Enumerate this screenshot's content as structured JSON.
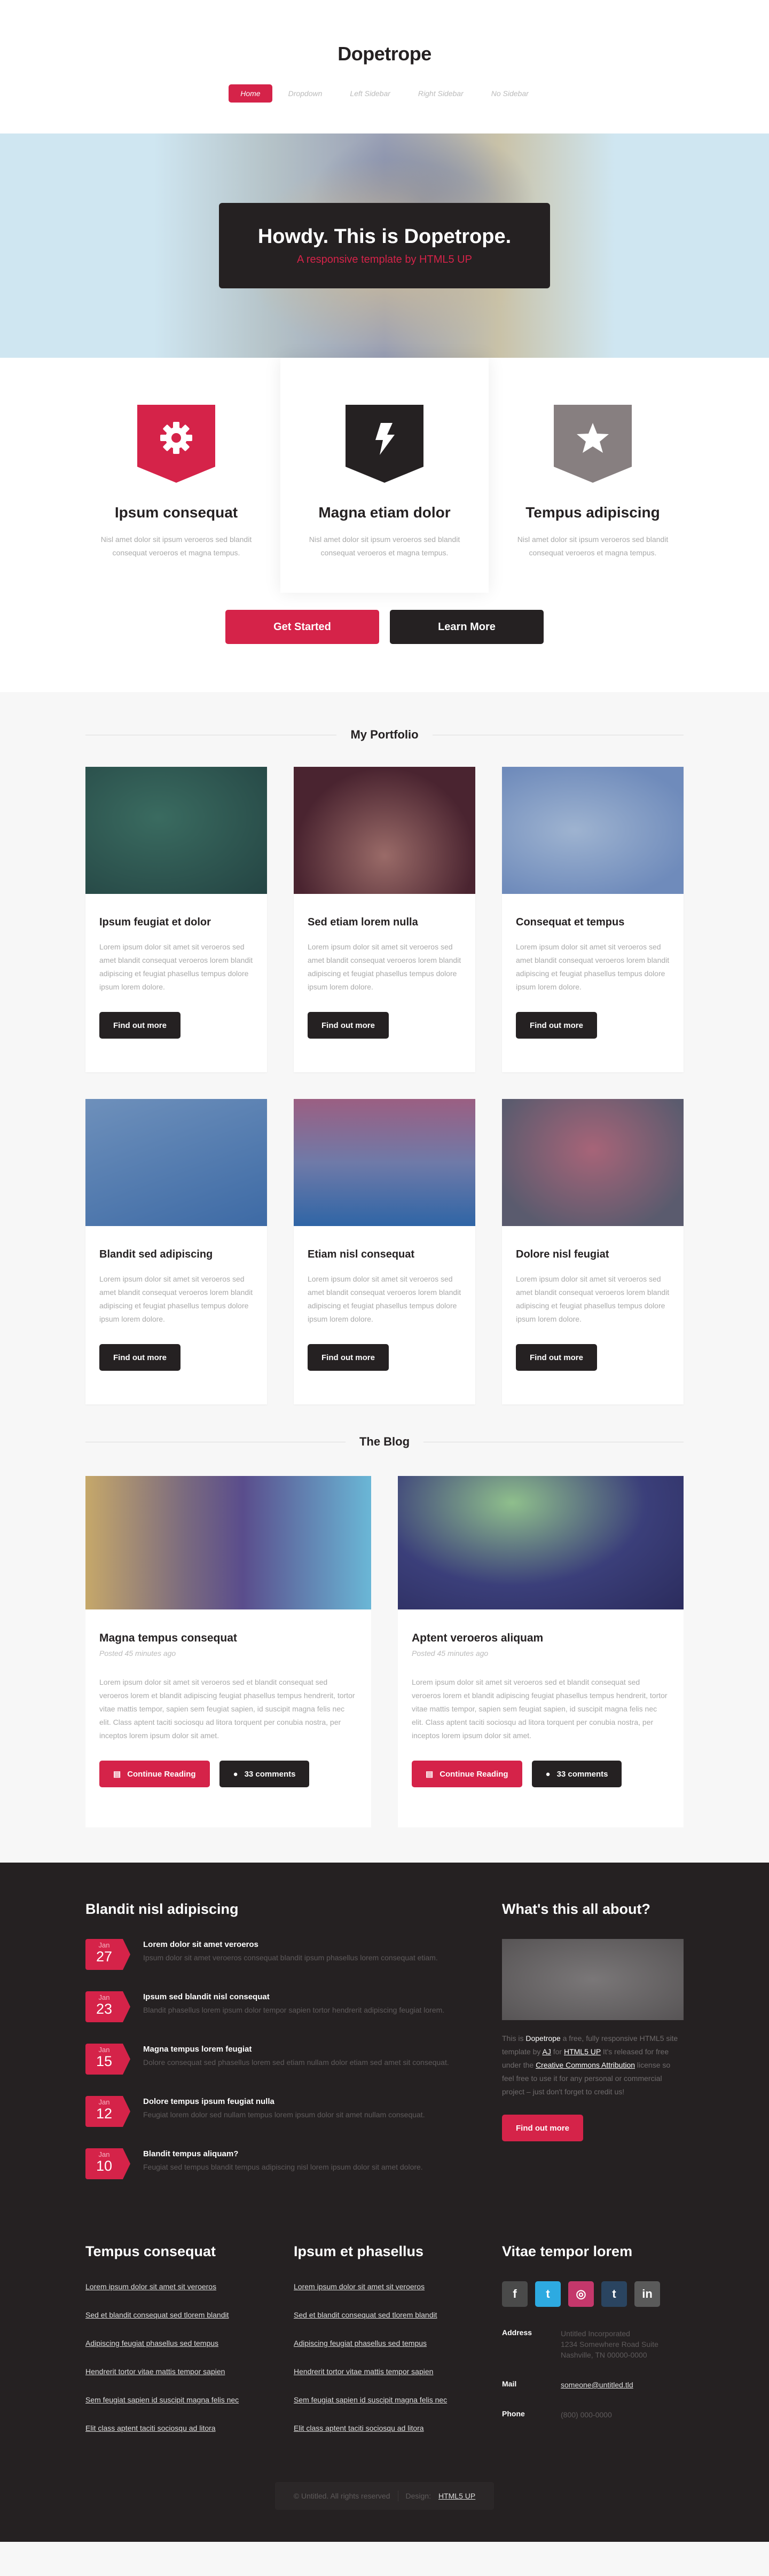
{
  "site": {
    "logo": "Dopetrope"
  },
  "nav": [
    {
      "label": "Home",
      "active": true
    },
    {
      "label": "Dropdown",
      "active": false
    },
    {
      "label": "Left Sidebar",
      "active": false
    },
    {
      "label": "Right Sidebar",
      "active": false
    },
    {
      "label": "No Sidebar",
      "active": false
    }
  ],
  "banner": {
    "title": "Howdy. This is Dopetrope.",
    "subtitle": "A responsive template by HTML5 UP"
  },
  "features": [
    {
      "icon": "gear-icon",
      "title": "Ipsum consequat",
      "text": "Nisl amet dolor sit ipsum veroeros sed blandit consequat veroeros et magna tempus.",
      "color": "#d52349"
    },
    {
      "icon": "bolt-icon",
      "title": "Magna etiam dolor",
      "text": "Nisl amet dolor sit ipsum veroeros sed blandit consequat veroeros et magna tempus.",
      "color": "#252122"
    },
    {
      "icon": "star-icon",
      "title": "Tempus adipiscing",
      "text": "Nisl amet dolor sit ipsum veroeros sed blandit consequat veroeros et magna tempus.",
      "color": "#877f80"
    }
  ],
  "intro_buttons": {
    "primary": "Get Started",
    "secondary": "Learn More"
  },
  "portfolio": {
    "title": "My Portfolio",
    "items": [
      {
        "title": "Ipsum feugiat et dolor",
        "text": "Lorem ipsum dolor sit amet sit veroeros sed amet blandit consequat veroeros lorem blandit adipiscing et feugiat phasellus tempus dolore ipsum lorem dolore.",
        "button": "Find out more"
      },
      {
        "title": "Sed etiam lorem nulla",
        "text": "Lorem ipsum dolor sit amet sit veroeros sed amet blandit consequat veroeros lorem blandit adipiscing et feugiat phasellus tempus dolore ipsum lorem dolore.",
        "button": "Find out more"
      },
      {
        "title": "Consequat et tempus",
        "text": "Lorem ipsum dolor sit amet sit veroeros sed amet blandit consequat veroeros lorem blandit adipiscing et feugiat phasellus tempus dolore ipsum lorem dolore.",
        "button": "Find out more"
      },
      {
        "title": "Blandit sed adipiscing",
        "text": "Lorem ipsum dolor sit amet sit veroeros sed amet blandit consequat veroeros lorem blandit adipiscing et feugiat phasellus tempus dolore ipsum lorem dolore.",
        "button": "Find out more"
      },
      {
        "title": "Etiam nisl consequat",
        "text": "Lorem ipsum dolor sit amet sit veroeros sed amet blandit consequat veroeros lorem blandit adipiscing et feugiat phasellus tempus dolore ipsum lorem dolore.",
        "button": "Find out more"
      },
      {
        "title": "Dolore nisl feugiat",
        "text": "Lorem ipsum dolor sit amet sit veroeros sed amet blandit consequat veroeros lorem blandit adipiscing et feugiat phasellus tempus dolore ipsum lorem dolore.",
        "button": "Find out more"
      }
    ]
  },
  "blog": {
    "title": "The Blog",
    "posts": [
      {
        "title": "Magna tempus consequat",
        "meta": "Posted 45 minutes ago",
        "text": "Lorem ipsum dolor sit amet sit veroeros sed et blandit consequat sed veroeros lorem et blandit adipiscing feugiat phasellus tempus hendrerit, tortor vitae mattis tempor, sapien sem feugiat sapien, id suscipit magna felis nec elit. Class aptent taciti sociosqu ad litora torquent per conubia nostra, per inceptos lorem ipsum dolor sit amet.",
        "read": "Continue Reading",
        "comments": "33 comments"
      },
      {
        "title": "Aptent veroeros aliquam",
        "meta": "Posted 45 minutes ago",
        "text": "Lorem ipsum dolor sit amet sit veroeros sed et blandit consequat sed veroeros lorem et blandit adipiscing feugiat phasellus tempus hendrerit, tortor vitae mattis tempor, sapien sem feugiat sapien, id suscipit magna felis nec elit. Class aptent taciti sociosqu ad litora torquent per conubia nostra, per inceptos lorem ipsum dolor sit amet.",
        "read": "Continue Reading",
        "comments": "33 comments"
      }
    ]
  },
  "footer": {
    "news_title": "Blandit nisl adipiscing",
    "news": [
      {
        "month": "Jan",
        "day": "27",
        "title": "Lorem dolor sit amet veroeros",
        "text": "Ipsum dolor sit amet veroeros consequat blandit ipsum phasellus lorem consequat etiam."
      },
      {
        "month": "Jan",
        "day": "23",
        "title": "Ipsum sed blandit nisl consequat",
        "text": "Blandit phasellus lorem ipsum dolor tempor sapien tortor hendrerit adipiscing feugiat lorem."
      },
      {
        "month": "Jan",
        "day": "15",
        "title": "Magna tempus lorem feugiat",
        "text": "Dolore consequat sed phasellus lorem sed etiam nullam dolor etiam sed amet sit consequat."
      },
      {
        "month": "Jan",
        "day": "12",
        "title": "Dolore tempus ipsum feugiat nulla",
        "text": "Feugiat lorem dolor sed nullam tempus lorem ipsum dolor sit amet nullam consequat."
      },
      {
        "month": "Jan",
        "day": "10",
        "title": "Blandit tempus aliquam?",
        "text": "Feugiat sed tempus blandit tempus adipiscing nisl lorem ipsum dolor sit amet dolore."
      }
    ],
    "about": {
      "title": "What's this all about?",
      "text_pre": "This is ",
      "text_brand": "Dopetrope",
      "text_mid": " a free, fully responsive HTML5 site template by ",
      "text_aj": "AJ",
      "text_for": " for ",
      "text_html5up": "HTML5 UP",
      "text_rel": " It's released for free under the ",
      "text_cc": "Creative Commons Attribution",
      "text_post": " license so feel free to use it for any personal or commercial project – just don't forget to credit us!",
      "button": "Find out more"
    },
    "links1": {
      "title": "Tempus consequat",
      "items": [
        "Lorem ipsum dolor sit amet sit veroeros",
        "Sed et blandit consequat sed tlorem blandit",
        "Adipiscing feugiat phasellus sed tempus",
        "Hendrerit tortor vitae mattis tempor sapien",
        "Sem feugiat sapien id suscipit magna felis nec",
        "Elit class aptent taciti sociosqu ad litora"
      ]
    },
    "links2": {
      "title": "Ipsum et phasellus",
      "items": [
        "Lorem ipsum dolor sit amet sit veroeros",
        "Sed et blandit consequat sed tlorem blandit",
        "Adipiscing feugiat phasellus sed tempus",
        "Hendrerit tortor vitae mattis tempor sapien",
        "Sem feugiat sapien id suscipit magna felis nec",
        "Elit class aptent taciti sociosqu ad litora"
      ]
    },
    "contact": {
      "title": "Vitae tempor lorem",
      "socials": [
        {
          "icon": "facebook-icon",
          "glyph": "f",
          "color": "#3c5a98"
        },
        {
          "icon": "twitter-icon",
          "glyph": "t",
          "color": "#2daae1"
        },
        {
          "icon": "dribbble-icon",
          "glyph": "◎",
          "color": "#c4376b"
        },
        {
          "icon": "tumblr-icon",
          "glyph": "t",
          "color": "#2a4460"
        },
        {
          "icon": "linkedin-icon",
          "glyph": "in",
          "color": "#0077b5"
        }
      ],
      "address_label": "Address",
      "address_lines": [
        "Untitled Incorporated",
        "1234 Somewhere Road Suite",
        "Nashville, TN 00000-0000"
      ],
      "mail_label": "Mail",
      "mail": "someone@untitled.tld",
      "phone_label": "Phone",
      "phone": "(800) 000-0000"
    },
    "copyright": {
      "text": "© Untitled. All rights reserved",
      "design_label": "Design:",
      "design_link": "HTML5 UP"
    }
  }
}
